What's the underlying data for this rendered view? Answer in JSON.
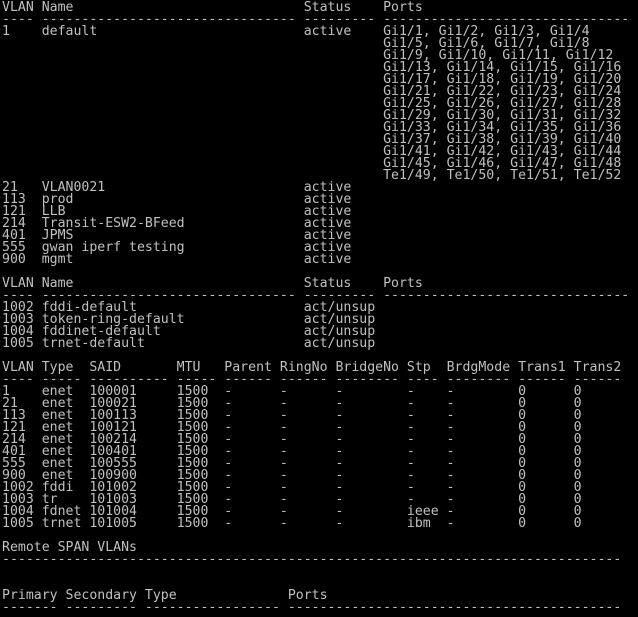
{
  "terminal": {
    "colors": {
      "background": "#000000",
      "text": "#c0c0c0"
    },
    "lines": [
      "VLAN Name                             Status    Ports",
      "---- -------------------------------- --------- -------------------------------",
      "1    default                          active    Gi1/1, Gi1/2, Gi1/3, Gi1/4",
      "                                                Gi1/5, Gi1/6, Gi1/7, Gi1/8",
      "                                                Gi1/9, Gi1/10, Gi1/11, Gi1/12",
      "                                                Gi1/13, Gi1/14, Gi1/15, Gi1/16",
      "                                                Gi1/17, Gi1/18, Gi1/19, Gi1/20",
      "                                                Gi1/21, Gi1/22, Gi1/23, Gi1/24",
      "                                                Gi1/25, Gi1/26, Gi1/27, Gi1/28",
      "                                                Gi1/29, Gi1/30, Gi1/31, Gi1/32",
      "                                                Gi1/33, Gi1/34, Gi1/35, Gi1/36",
      "                                                Gi1/37, Gi1/38, Gi1/39, Gi1/40",
      "                                                Gi1/41, Gi1/42, Gi1/43, Gi1/44",
      "                                                Gi1/45, Gi1/46, Gi1/47, Gi1/48",
      "                                                Te1/49, Te1/50, Te1/51, Te1/52",
      "21   VLAN0021                         active",
      "113  prod                             active",
      "121  LLB                              active",
      "214  Transit-ESW2-BFeed               active",
      "401  JPMS                             active",
      "555  gwan iperf testing               active",
      "900  mgmt                             active",
      "",
      "VLAN Name                             Status    Ports",
      "---- -------------------------------- --------- -------------------------------",
      "1002 fddi-default                     act/unsup",
      "1003 token-ring-default               act/unsup",
      "1004 fddinet-default                  act/unsup",
      "1005 trnet-default                    act/unsup",
      "",
      "VLAN Type  SAID       MTU   Parent RingNo BridgeNo Stp  BrdgMode Trans1 Trans2",
      "---- ----- ---------- ----- ------ ------ -------- ---- -------- ------ ------",
      "1    enet  100001     1500  -      -      -        -    -        0      0",
      "21   enet  100021     1500  -      -      -        -    -        0      0",
      "113  enet  100113     1500  -      -      -        -    -        0      0",
      "121  enet  100121     1500  -      -      -        -    -        0      0",
      "214  enet  100214     1500  -      -      -        -    -        0      0",
      "401  enet  100401     1500  -      -      -        -    -        0      0",
      "555  enet  100555     1500  -      -      -        -    -        0      0",
      "900  enet  100900     1500  -      -      -        -    -        0      0",
      "1002 fddi  101002     1500  -      -      -        -    -        0      0",
      "1003 tr    101003     1500  -      -      -        -    -        0      0",
      "1004 fdnet 101004     1500  -      -      -        ieee -        0      0",
      "1005 trnet 101005     1500  -      -      -        ibm  -        0      0",
      "",
      "Remote SPAN VLANs",
      "------------------------------------------------------------------------------",
      "",
      "",
      "Primary Secondary Type              Ports",
      "------- --------- ----------------- ------------------------------------------"
    ]
  }
}
